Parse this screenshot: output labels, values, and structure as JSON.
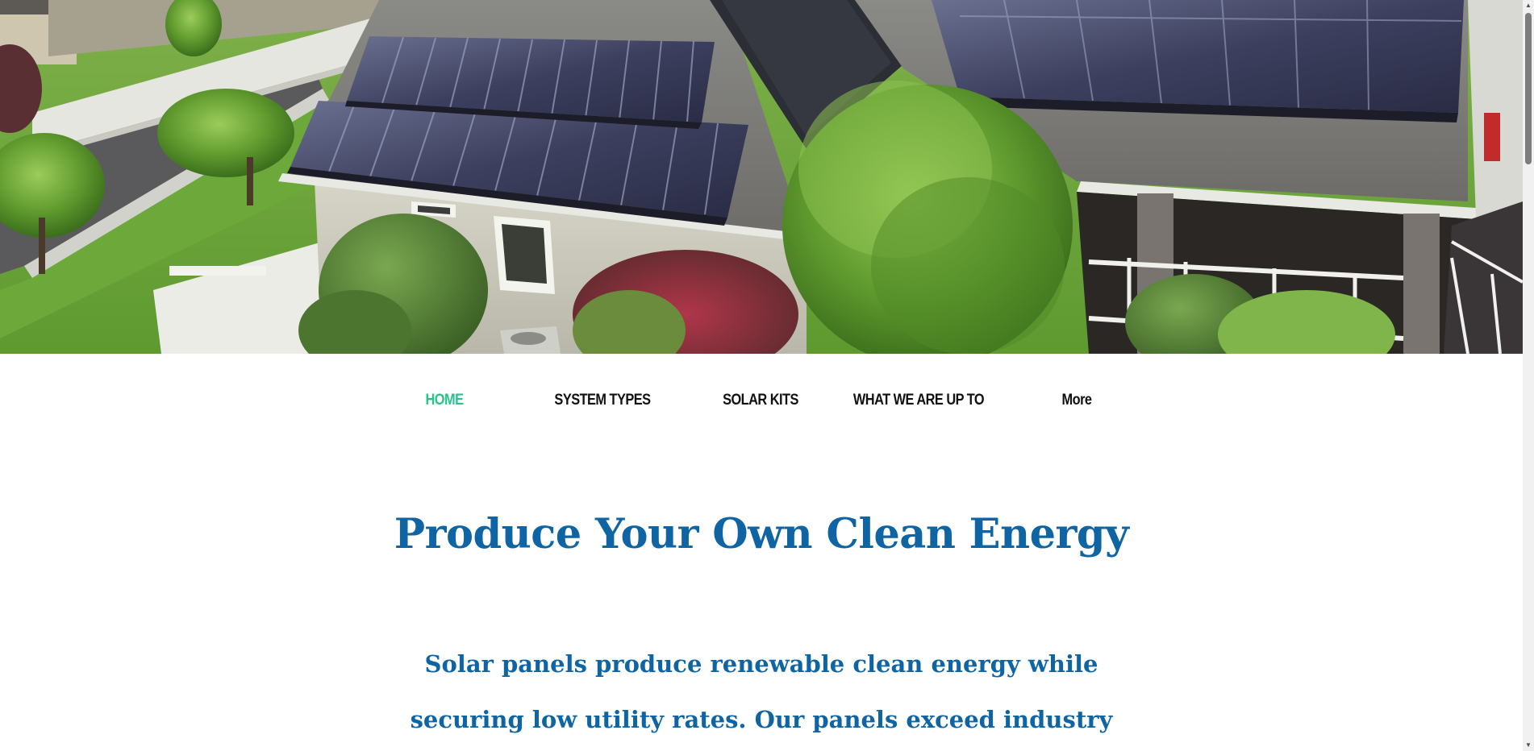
{
  "hero": {
    "image_subject": "aerial-house-with-solar-panels"
  },
  "nav": {
    "items": [
      {
        "label": "HOME",
        "active": true
      },
      {
        "label": "SYSTEM TYPES",
        "active": false
      },
      {
        "label": "SOLAR KITS",
        "active": false
      },
      {
        "label": "WHAT WE ARE UP TO",
        "active": false
      },
      {
        "label": "More",
        "active": false
      }
    ]
  },
  "content": {
    "headline": "Produce Your Own Clean Energy",
    "intro_line_1": "Solar panels produce renewable clean energy while",
    "intro_line_2": "securing low utility rates. Our panels exceed industry"
  },
  "colors": {
    "accent_green": "#26c48a",
    "heading_blue": "#0f64a3",
    "nav_text": "#111111"
  }
}
